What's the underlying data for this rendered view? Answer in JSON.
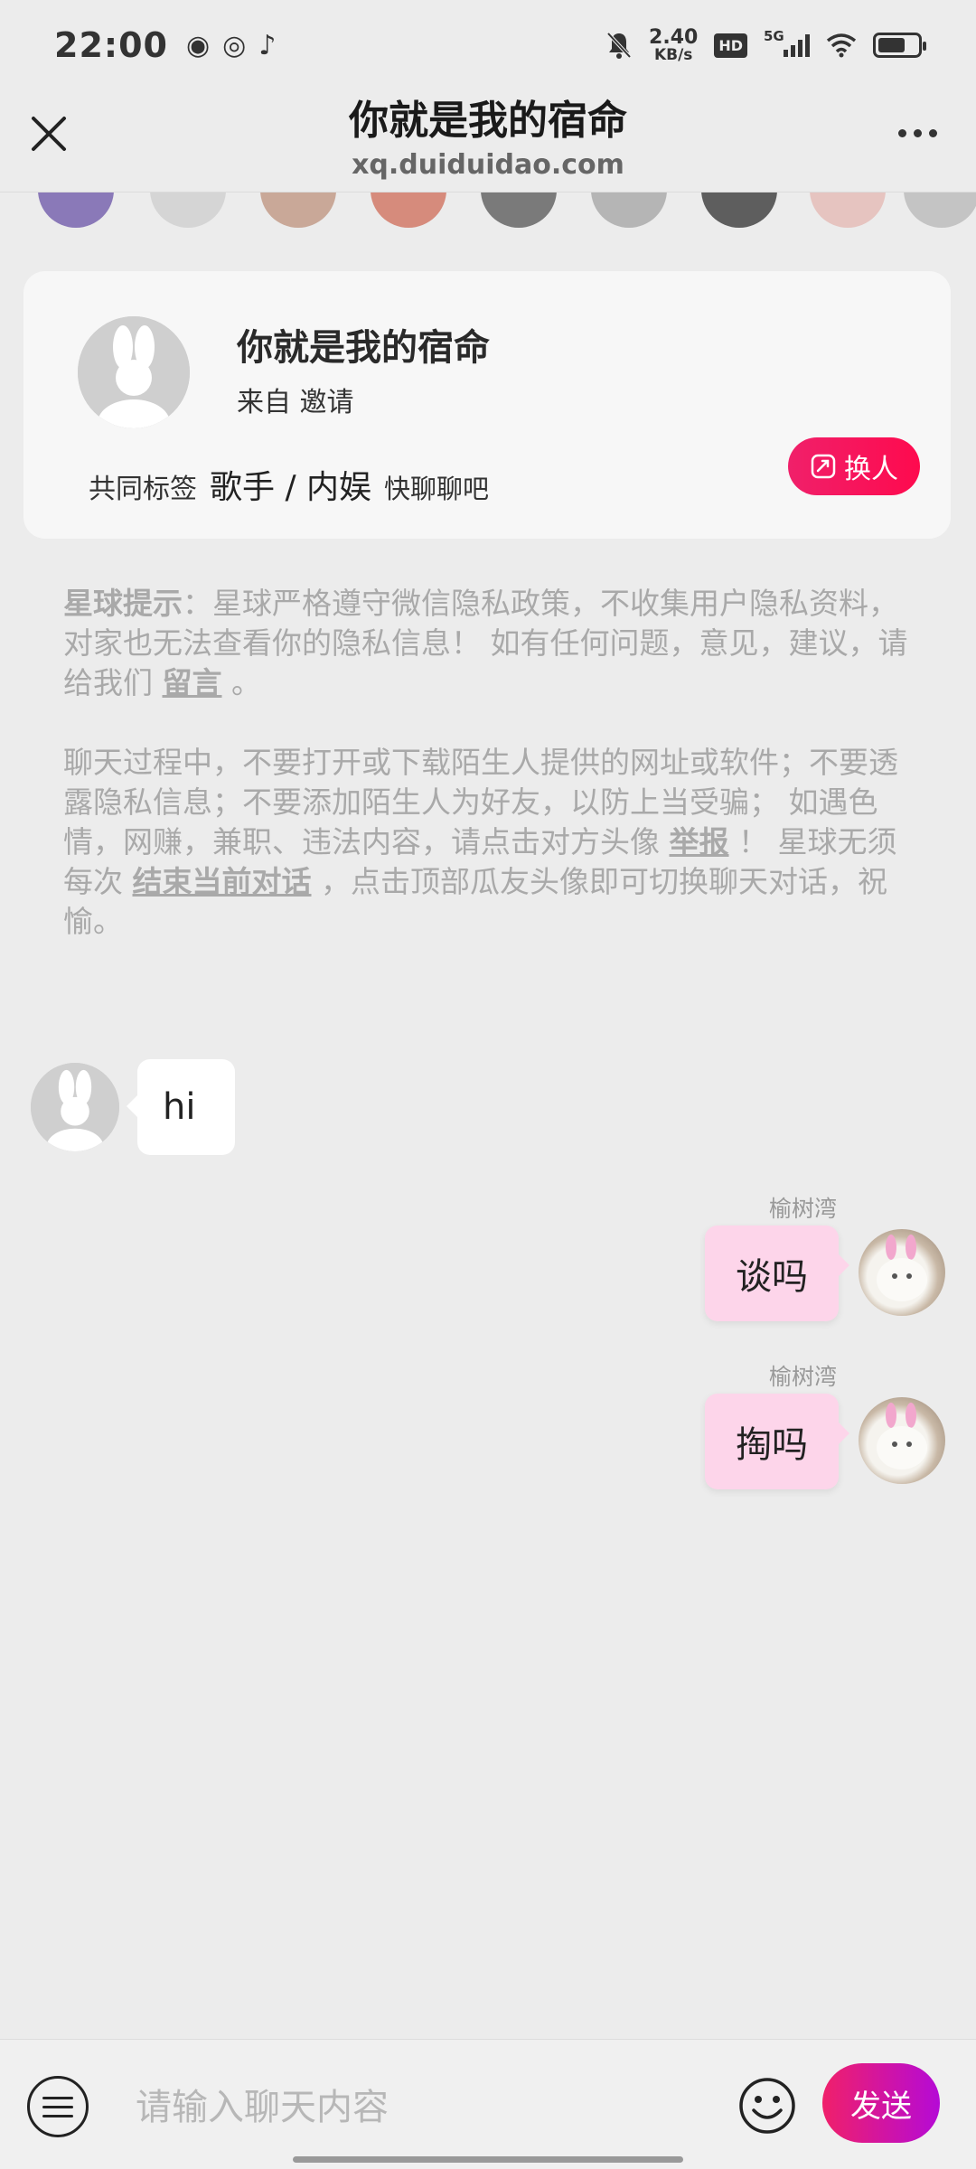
{
  "status_bar": {
    "time": "22:00",
    "app_icons": [
      "weibo-icon",
      "wechat-icon",
      "tiktok-icon"
    ],
    "net_speed_value": "2.40",
    "net_speed_unit": "KB/s",
    "hd_badge": "HD",
    "signal_label": "5G",
    "battery_level": 0.7
  },
  "header": {
    "title": "你就是我的宿命",
    "url": "xq.duiduidao.com"
  },
  "profile": {
    "name": "你就是我的宿命",
    "from_label": "来自 邀请",
    "tags_label": "共同标签",
    "tags_value": "歌手 / 内娱",
    "tags_hint": "快聊聊吧",
    "swap_button": "换人"
  },
  "notice": {
    "p1_bold": "星球提示",
    "p1_text": "：星球严格遵守微信隐私政策，不收集用户隐私资料，对家也无法查看你的隐私信息！ 如有任何问题，意见，建议，请给我们 ",
    "p1_link": "留言",
    "p1_end": " 。",
    "p2_text_a": "聊天过程中，不要打开或下载陌生人提供的网址或软件；不要透露隐私信息；不要添加陌生人为好友，以防上当受骗； 如遇色情，网赚，兼职、违法内容，请点击对方头像 ",
    "p2_link_report": "举报",
    "p2_text_b": " ！ 星球无须每次 ",
    "p2_link_end": "结束当前对话",
    "p2_text_c": " ，点击顶部瓜友头像即可切换聊天对话，祝愉。"
  },
  "messages": [
    {
      "side": "left",
      "text": "hi"
    },
    {
      "side": "right",
      "sender": "榆树湾",
      "text": "谈吗"
    },
    {
      "side": "right",
      "sender": "榆树湾",
      "text": "掏吗"
    }
  ],
  "input": {
    "placeholder": "请输入聊天内容",
    "send_label": "发送"
  },
  "colors": {
    "accent_pink": "#f0206a",
    "accent_purple": "#b50ad6",
    "bubble_pink": "#fdd5ea"
  }
}
